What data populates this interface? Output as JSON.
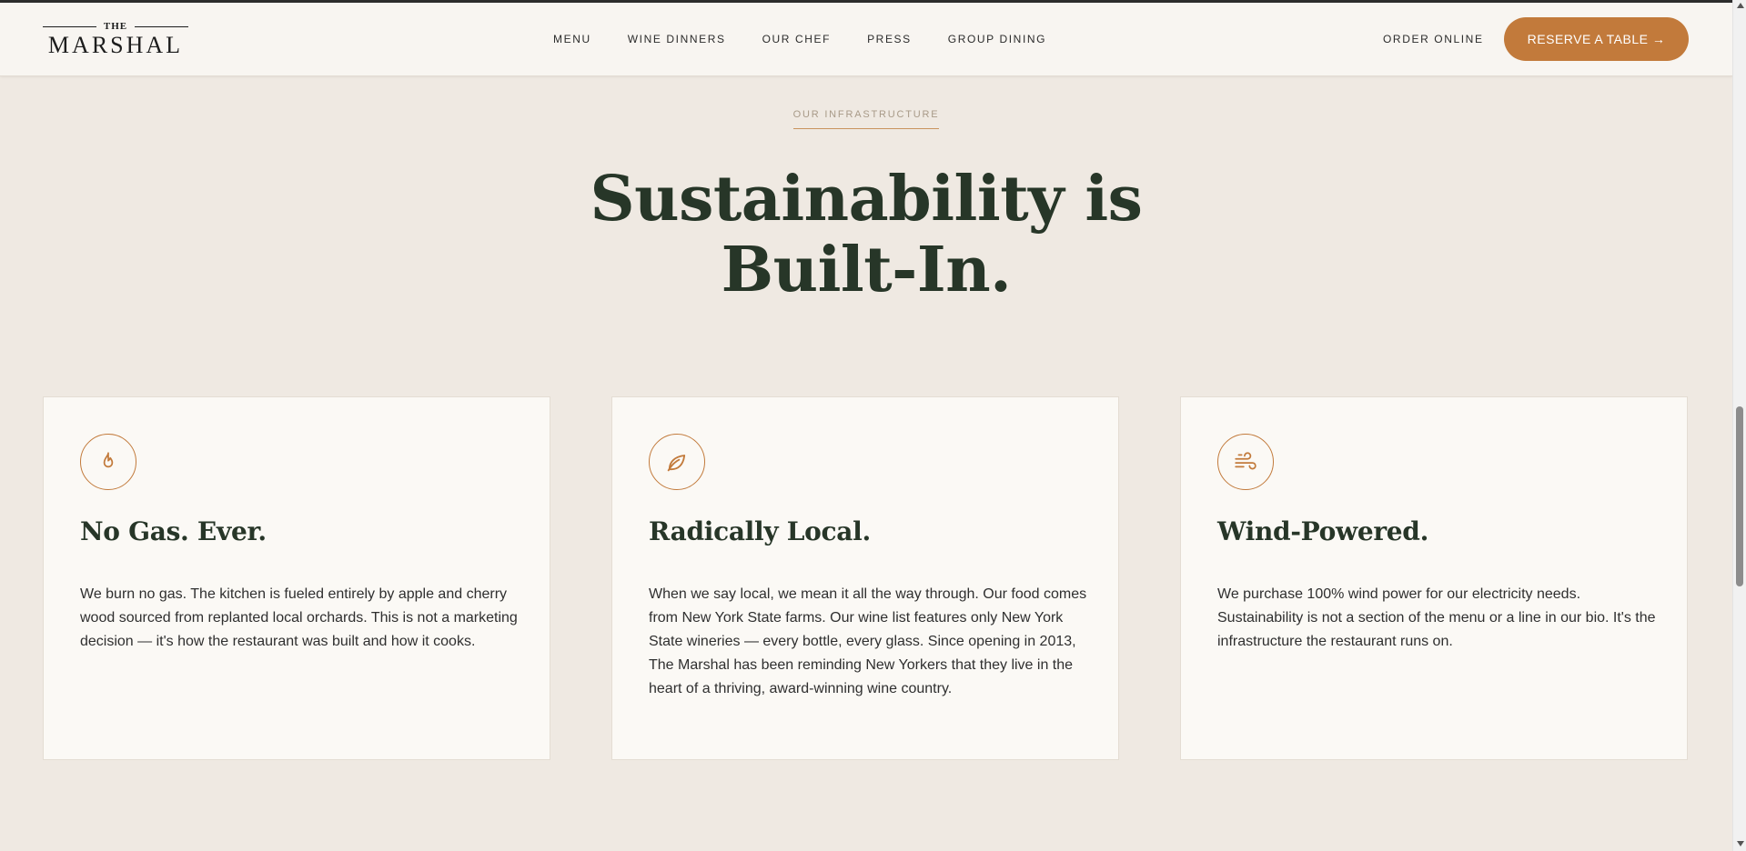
{
  "header": {
    "logo": {
      "the": "THE",
      "name": "MARSHAL"
    },
    "nav": [
      "MENU",
      "WINE DINNERS",
      "OUR CHEF",
      "PRESS",
      "GROUP DINING"
    ],
    "order_online": "ORDER ONLINE",
    "reserve": "RESERVE A TABLE →"
  },
  "section": {
    "eyebrow": "OUR INFRASTRUCTURE",
    "headline_line1": "Sustainability is",
    "headline_line2": "Built-In."
  },
  "cards": [
    {
      "icon": "flame-icon",
      "title": "No Gas. Ever.",
      "body": "We burn no gas. The kitchen is fueled entirely by apple and cherry wood sourced from replanted local orchards. This is not a marketing decision — it's how the restaurant was built and how it cooks."
    },
    {
      "icon": "leaf-icon",
      "title": "Radically Local.",
      "body": "When we say local, we mean it all the way through. Our food comes from New York State farms. Our wine list features only New York State wineries — every bottle, every glass. Since opening in 2013, The Marshal has been reminding New Yorkers that they live in the heart of a thriving, award-winning wine country."
    },
    {
      "icon": "wind-icon",
      "title": "Wind-Powered.",
      "body": "We purchase 100% wind power for our electricity needs. Sustainability is not a section of the menu or a line in our bio. It's the infrastructure the restaurant runs on."
    }
  ],
  "colors": {
    "accent": "#c27a3b",
    "heading": "#273628",
    "page_bg": "#efe9e2",
    "card_bg": "#fbf9f5"
  }
}
